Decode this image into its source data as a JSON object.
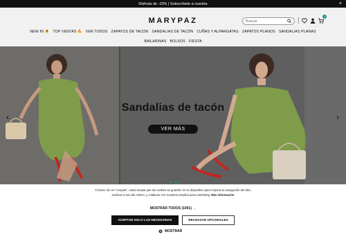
{
  "promo": {
    "text": "Disfruta de -10% | Subscríbete a nuestra",
    "close": "×"
  },
  "header": {
    "logo": "MARYPAZ",
    "search_placeholder": "Buscar",
    "cart_count": "0"
  },
  "nav": [
    "NEW IN 🌻",
    "TOP VENTAS 🔥",
    "VER TODOS",
    "ZAPATOS DE TACÓN",
    "SANDALIAS DE TACÓN",
    "CUÑAS Y ALPARGATAS",
    "ZAPATOS PLANOS",
    "SANDALIAS PLANAS",
    "BAILARINAS",
    "BOLSOS",
    "FIESTA"
  ],
  "hero": {
    "title": "Sandalias de tacón",
    "button": "VER MÁS",
    "prev": "‹",
    "next": "›"
  },
  "cookie": {
    "text_1": "Al hacer clic en \"Aceptar\", usted acepta que las cookies se guarden en su dispositivo para mejorar la navegación del sitio, analizar el uso del mismo, y colaborar con nuestros estudios para marketing.",
    "more": "Más información",
    "show_all": "MOSTRAR TODOS (1091) →",
    "accept": "ACEPTAR SOLO LAS NECESARIAS",
    "reject": "RECHAZAR OPCIONALES",
    "show": "MOSTRAR"
  },
  "colors": {
    "accent": "#1a8f8f",
    "dress": "#7e9c4a",
    "shoe": "#c0281e"
  }
}
